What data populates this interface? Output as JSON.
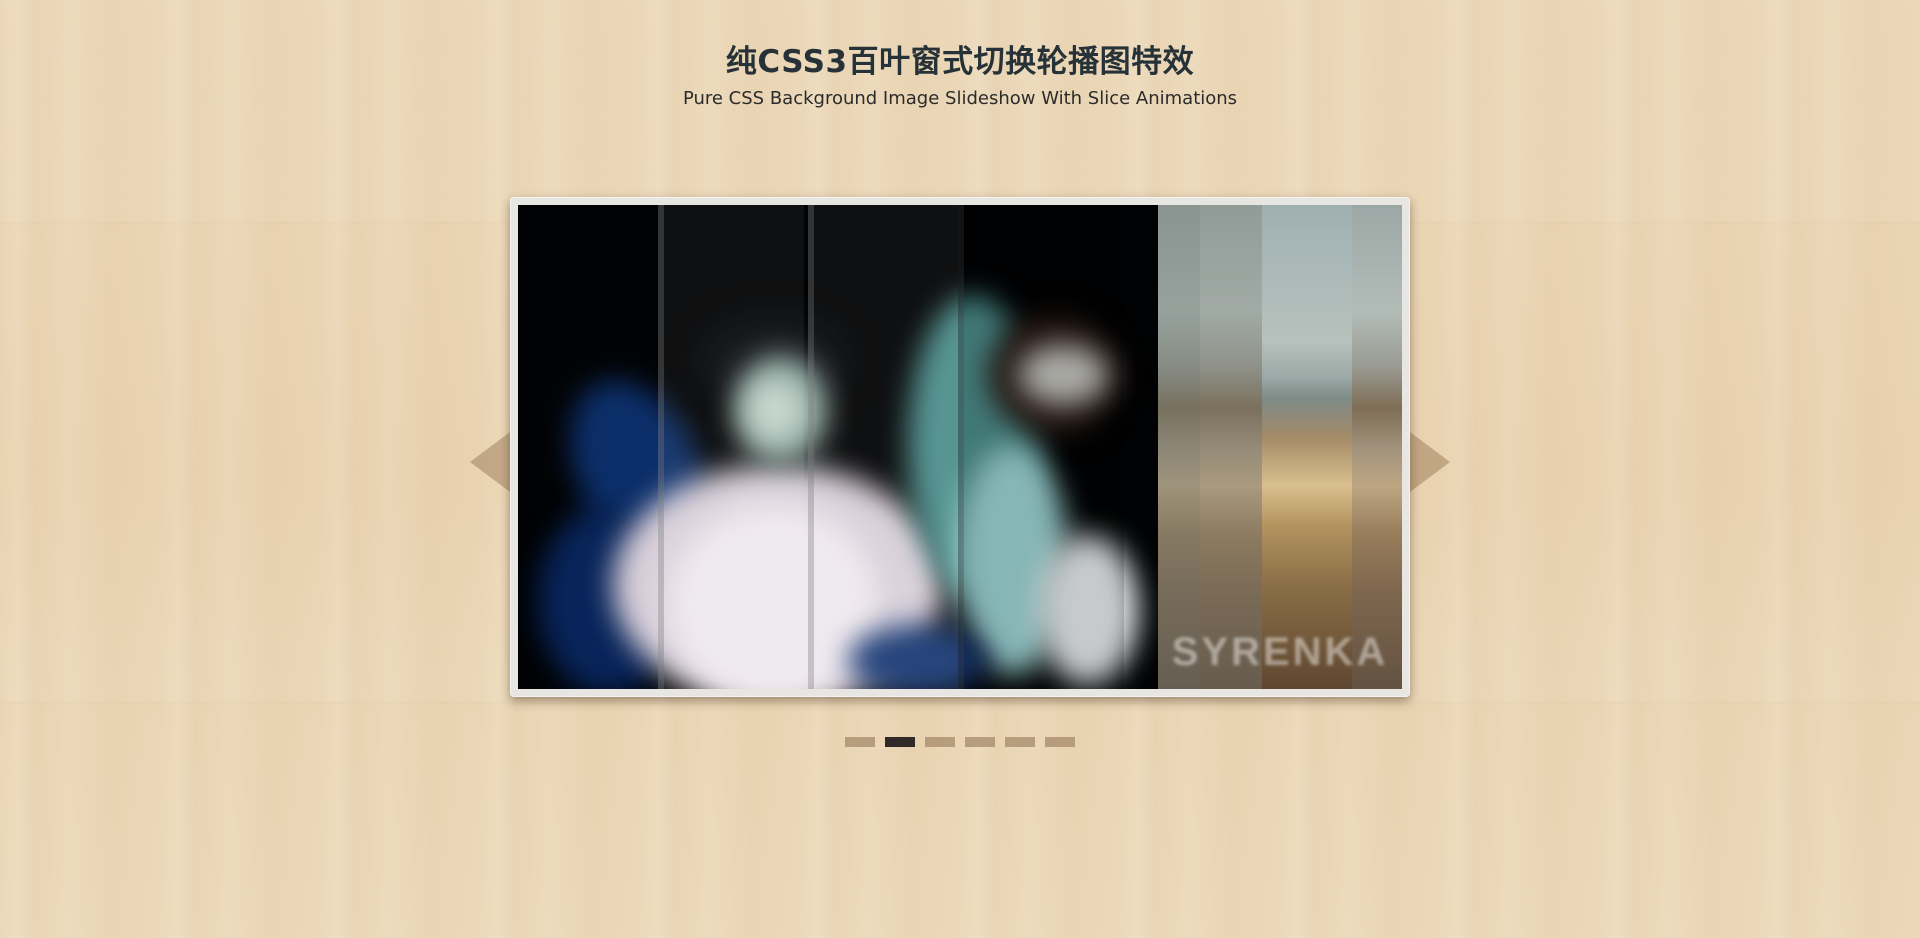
{
  "header": {
    "title": "纯CSS3百叶窗式切换轮播图特效",
    "subtitle": "Pure CSS Background Image Slideshow With Slice Animations"
  },
  "slider": {
    "watermark": "SYRENKA",
    "dots_total": 6,
    "active_dot": 2
  },
  "colors": {
    "title": "#263238",
    "dot_active": "#2f2a27",
    "dot_inactive": "#a08464"
  },
  "icons": {
    "prev": "arrow-left-icon",
    "next": "arrow-right-icon"
  }
}
